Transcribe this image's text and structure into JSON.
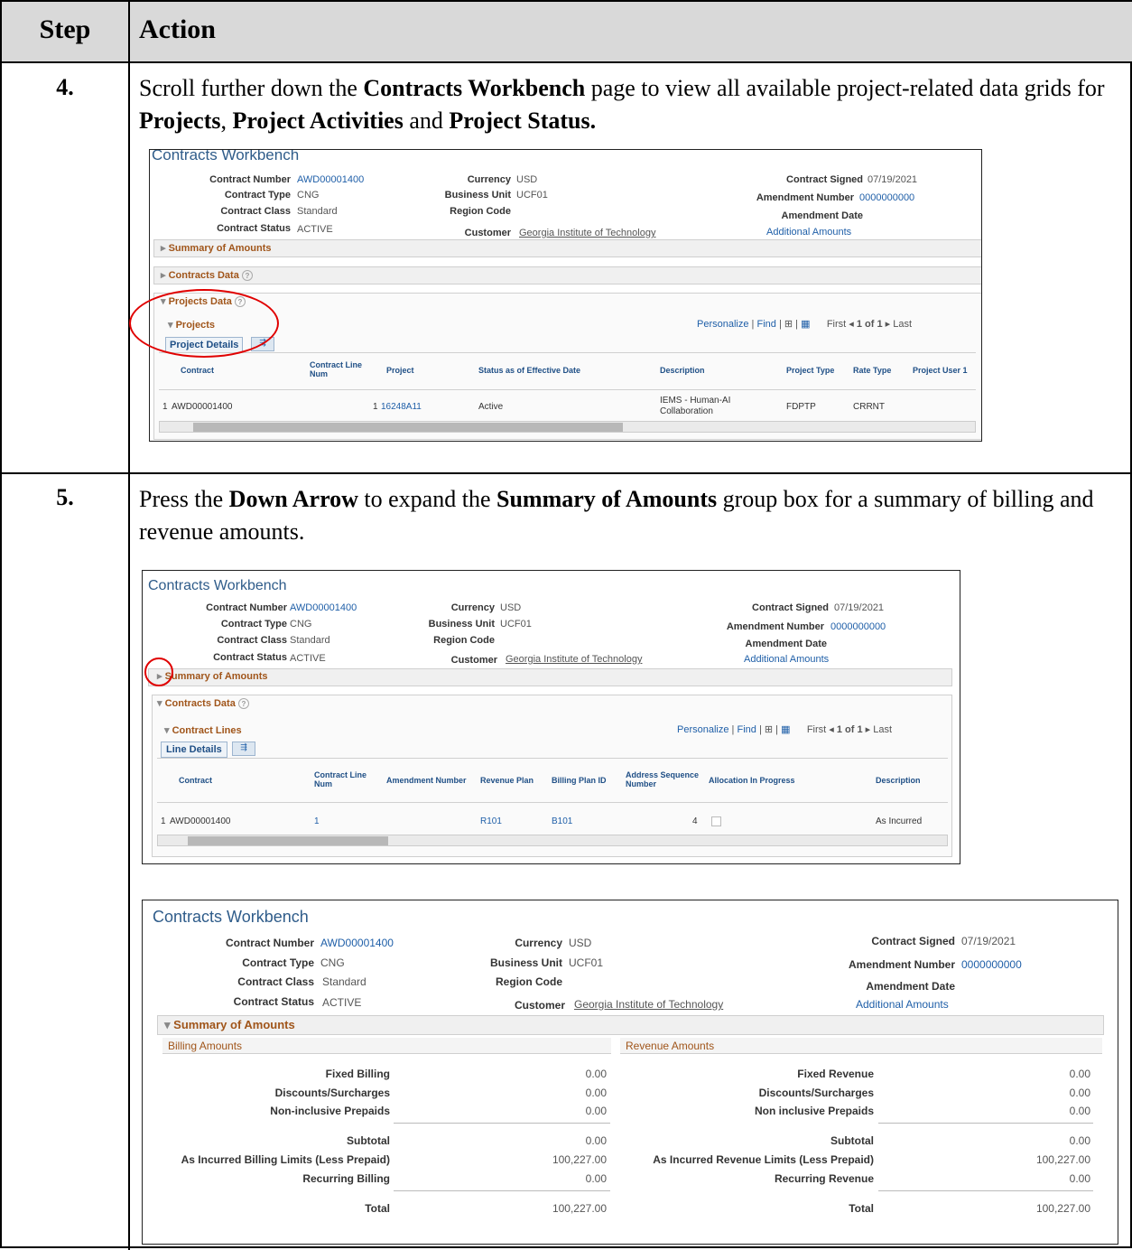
{
  "header": {
    "step": "Step",
    "action": "Action"
  },
  "steps": [
    {
      "number": "4.",
      "text_parts": [
        "Scroll further down the ",
        "Contracts Workbench",
        " page to view all available project-related data grids for ",
        "Projects",
        ", ",
        "Project Activities",
        " and ",
        "Project Status."
      ]
    },
    {
      "number": "5.",
      "text_parts": [
        "Press the ",
        "Down Arrow",
        " to expand the ",
        "Summary of Amounts",
        " group box for a summary of billing and revenue amounts."
      ]
    }
  ],
  "workbench": {
    "title": "Contracts Workbench",
    "contract_number_label": "Contract Number",
    "contract_number": "AWD00001400",
    "contract_type_label": "Contract Type",
    "contract_type": "CNG",
    "contract_class_label": "Contract Class",
    "contract_class": "Standard",
    "contract_status_label": "Contract Status",
    "contract_status": "ACTIVE",
    "currency_label": "Currency",
    "currency": "USD",
    "business_unit_label": "Business Unit",
    "business_unit": "UCF01",
    "region_code_label": "Region Code",
    "customer_label": "Customer",
    "customer": "Georgia Institute of Technology",
    "contract_signed_label": "Contract Signed",
    "contract_signed": "07/19/2021",
    "amendment_number_label": "Amendment Number",
    "amendment_number": "0000000000",
    "amendment_date_label": "Amendment Date",
    "additional_amounts": "Additional Amounts",
    "summary_of_amounts": "Summary of Amounts",
    "contracts_data": "Contracts Data",
    "projects_data": "Projects Data",
    "help_glyph": "?"
  },
  "nav": {
    "personalize": "Personalize",
    "find": "Find",
    "first": "First",
    "range": "1 of 1",
    "last": "Last",
    "sep": "|"
  },
  "projects_grid": {
    "title": "Projects",
    "tab": "Project Details",
    "columns": [
      "Contract",
      "Contract Line Num",
      "Project",
      "Status as of Effective Date",
      "Description",
      "Project Type",
      "Rate Type",
      "Project User 1"
    ],
    "row": {
      "index": "1",
      "contract": "AWD00001400",
      "line": "1",
      "project": "16248A11",
      "status": "Active",
      "description": "IEMS - Human-AI Collaboration",
      "project_type": "FDPTP",
      "rate_type": "CRRNT"
    }
  },
  "lines_grid": {
    "title": "Contract Lines",
    "tab": "Line Details",
    "columns": [
      "Contract",
      "Contract Line Num",
      "Amendment Number",
      "Revenue Plan",
      "Billing Plan ID",
      "Address Sequence Number",
      "Allocation In Progress",
      "Description"
    ],
    "row": {
      "index": "1",
      "contract": "AWD00001400",
      "line": "1",
      "revenue_plan": "R101",
      "billing_plan": "B101",
      "address_seq": "4",
      "description": "As Incurred"
    }
  },
  "amounts": {
    "billing_header": "Billing Amounts",
    "revenue_header": "Revenue Amounts",
    "billing": [
      {
        "label": "Fixed Billing",
        "value": "0.00"
      },
      {
        "label": "Discounts/Surcharges",
        "value": "0.00"
      },
      {
        "label": "Non-inclusive Prepaids",
        "value": "0.00"
      },
      {
        "label": "Subtotal",
        "value": "0.00"
      },
      {
        "label": "As Incurred Billing Limits (Less Prepaid)",
        "value": "100,227.00"
      },
      {
        "label": "Recurring Billing",
        "value": "0.00"
      },
      {
        "label": "Total",
        "value": "100,227.00"
      }
    ],
    "revenue": [
      {
        "label": "Fixed Revenue",
        "value": "0.00"
      },
      {
        "label": "Discounts/Surcharges",
        "value": "0.00"
      },
      {
        "label": "Non inclusive Prepaids",
        "value": "0.00"
      },
      {
        "label": "Subtotal",
        "value": "0.00"
      },
      {
        "label": "As Incurred Revenue Limits (Less Prepaid)",
        "value": "100,227.00"
      },
      {
        "label": "Recurring Revenue",
        "value": "0.00"
      },
      {
        "label": "Total",
        "value": "100,227.00"
      }
    ]
  },
  "colors": {
    "header_bg": "#d9d9d9",
    "link": "#1f5fa8",
    "group_title": "#a0551a",
    "annotation": "#e00000"
  }
}
